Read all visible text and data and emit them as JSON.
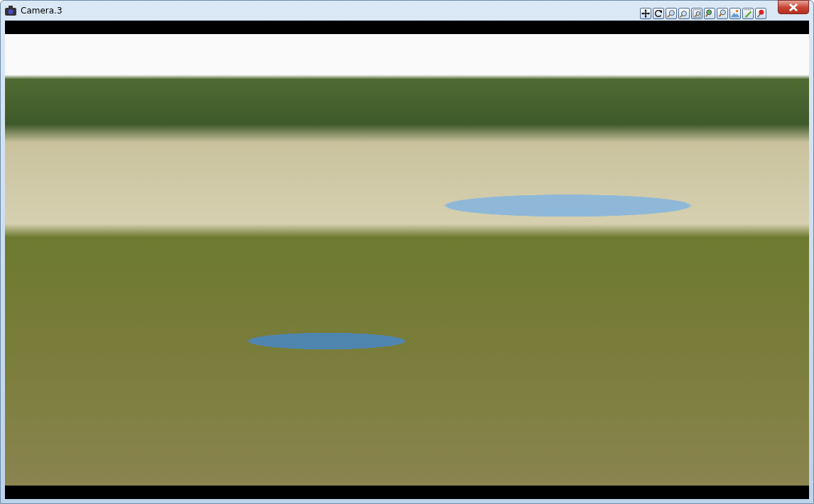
{
  "window": {
    "title": "Camera.3"
  }
}
